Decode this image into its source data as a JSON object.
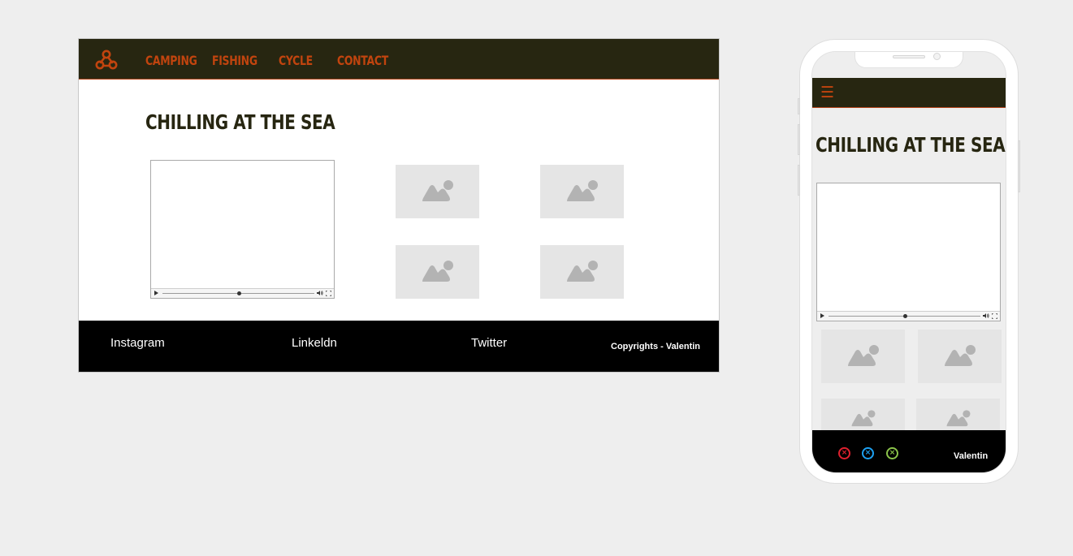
{
  "desktop": {
    "nav": [
      {
        "label": "CAMPING"
      },
      {
        "label": "FISHING"
      },
      {
        "label": "CYCLE"
      },
      {
        "label": "CONTACT"
      }
    ],
    "title": "CHILLING AT THE SEA",
    "video": {
      "progress": 0.5
    },
    "footer": {
      "social": [
        {
          "label": "Instagram"
        },
        {
          "label": "Linkeldn"
        },
        {
          "label": "Twitter"
        }
      ],
      "copyright": "Copyrights -  Valentin"
    }
  },
  "mobile": {
    "menu_icon": "☰",
    "title": "CHILLING AT THE SEA",
    "video": {
      "progress": 0.5
    },
    "footer": {
      "icons": [
        {
          "name": "instagram-icon",
          "color": "#e0202e"
        },
        {
          "name": "linkedin-icon",
          "color": "#1da1f2"
        },
        {
          "name": "twitter-icon",
          "color": "#8bc34a"
        }
      ],
      "copyright": "Valentin"
    }
  },
  "colors": {
    "header_bg": "#272611",
    "accent": "#c1440e",
    "footer_bg": "#000000",
    "placeholder": "#e5e5e5",
    "placeholder_icon": "#b3b3b3"
  }
}
